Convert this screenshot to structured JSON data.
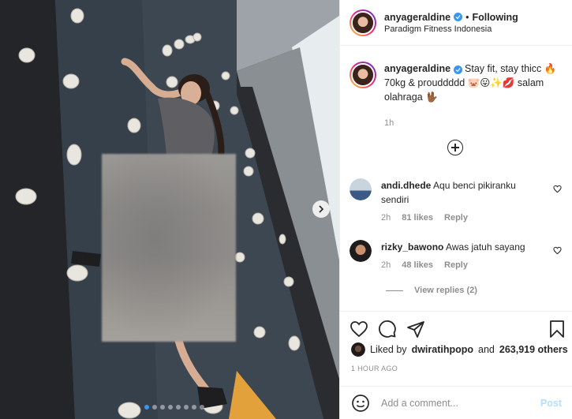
{
  "post": {
    "carousel": {
      "slide_count": 8,
      "active_index": 0
    }
  },
  "header": {
    "username": "anyageraldine",
    "separator": "•",
    "follow_state": "Following",
    "location": "Paradigm Fitness Indonesia"
  },
  "caption": {
    "username": "anyageraldine",
    "text": "Stay fit, stay thicc 🔥 70kg & prouddddd 🐷😛✨💋 salam olahraga 🖖🏾",
    "time": "1h"
  },
  "comments": [
    {
      "username": "andi.dhede",
      "text": "Aqu benci pikiranku sendiri",
      "time": "2h",
      "likes": "81 likes",
      "reply_label": "Reply"
    },
    {
      "username": "rizky_bawono",
      "text": "Awas jatuh sayang",
      "time": "2h",
      "likes": "48 likes",
      "reply_label": "Reply"
    }
  ],
  "view_replies": "View replies (2)",
  "likes": {
    "prefix": "Liked by",
    "first_liker": "dwiratihpopo",
    "and": "and",
    "others": "263,919 others"
  },
  "timestamp": "1 HOUR AGO",
  "add_comment": {
    "placeholder": "Add a comment...",
    "post_label": "Post"
  },
  "icons": {
    "like": "heart-icon",
    "comment": "comment-icon",
    "share": "paper-plane-icon",
    "save": "bookmark-icon",
    "emoji": "smiley-icon",
    "next": "chevron-right-icon",
    "load_more": "plus-circle-icon",
    "verified": "verified-badge-icon"
  },
  "colors": {
    "accent": "#3897f0",
    "muted": "#8e8e8e",
    "text": "#262626",
    "post_disabled": "#b2dffc"
  }
}
